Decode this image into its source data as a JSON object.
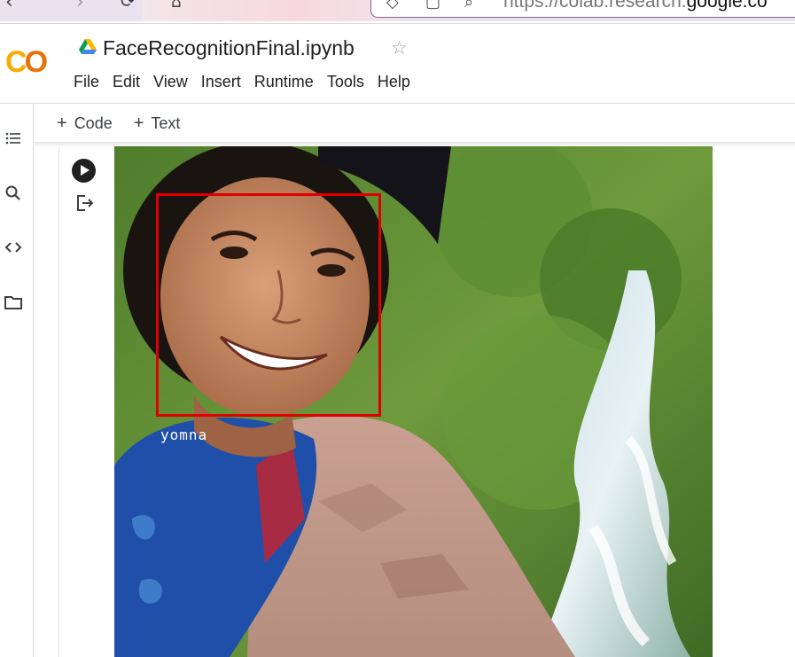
{
  "browser": {
    "url_prefix": "https://colab.research.",
    "url_domain": "google.co"
  },
  "header": {
    "logo": "CO",
    "title": "FaceRecognitionFinal.ipynb",
    "menu": [
      "File",
      "Edit",
      "View",
      "Insert",
      "Runtime",
      "Tools",
      "Help"
    ]
  },
  "toolbar": {
    "add_code": "Code",
    "add_text": "Text"
  },
  "output": {
    "face_label": "yomna",
    "box_color": "#e00000"
  },
  "colors": {
    "logo_yellow": "#f9ab00",
    "logo_orange": "#e8710a"
  }
}
